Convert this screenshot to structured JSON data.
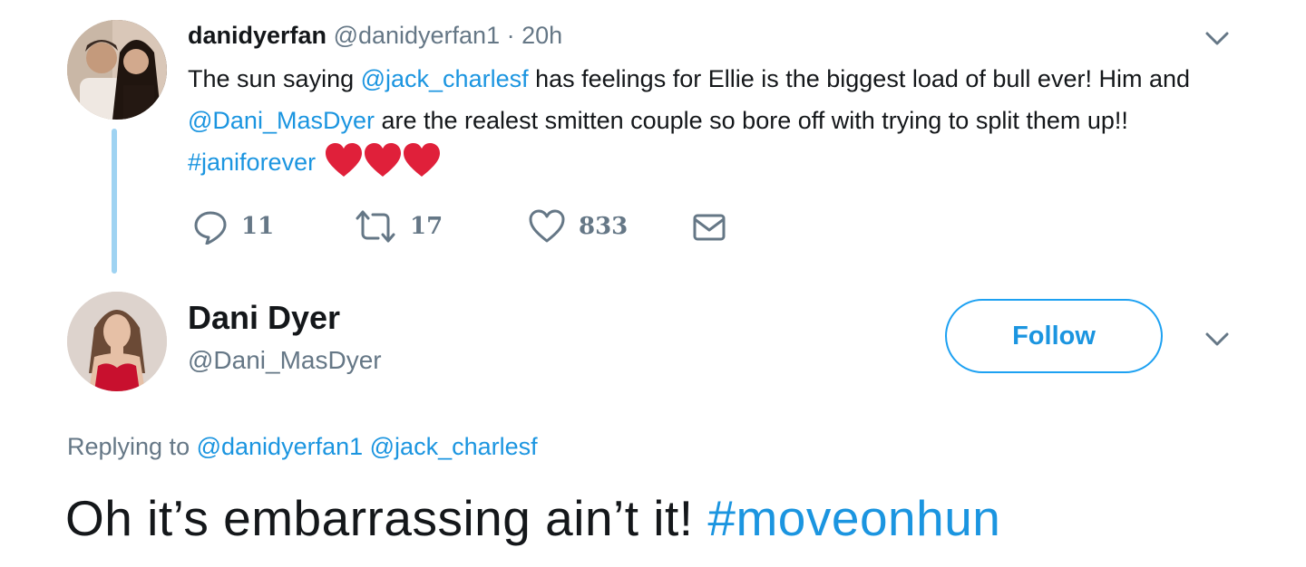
{
  "tweet1": {
    "display_name": "danidyerfan",
    "handle": "@danidyerfan1",
    "separator": "·",
    "time": "20h",
    "text": {
      "part1": "The sun saying ",
      "mention1": "@jack_charlesf",
      "part2": " has feelings for Ellie is the biggest load of bull ever!  Him and ",
      "mention2": "@Dani_MasDyer",
      "part3": " are the realest smitten couple so bore off with trying to split them up!! ",
      "hashtag": "#janiforever",
      "emoji_icons": [
        "red-heart-icon",
        "red-heart-icon",
        "red-heart-icon"
      ]
    },
    "actions": {
      "reply_count": "11",
      "retweet_count": "17",
      "like_count": "833"
    }
  },
  "tweet2": {
    "display_name": "Dani Dyer",
    "handle": "@Dani_MasDyer",
    "follow_label": "Follow",
    "replying_prefix": "Replying to ",
    "reply_mention1": "@danidyerfan1",
    "reply_mention2": "@jack_charlesf",
    "text": "Oh it’s embarrassing ain’t it! ",
    "hashtag": "#moveonhun"
  },
  "colors": {
    "link": "#1b95e0",
    "muted": "#657786",
    "text": "#14171a",
    "thread_line": "#9fd3f2",
    "heart": "#e0203a"
  }
}
